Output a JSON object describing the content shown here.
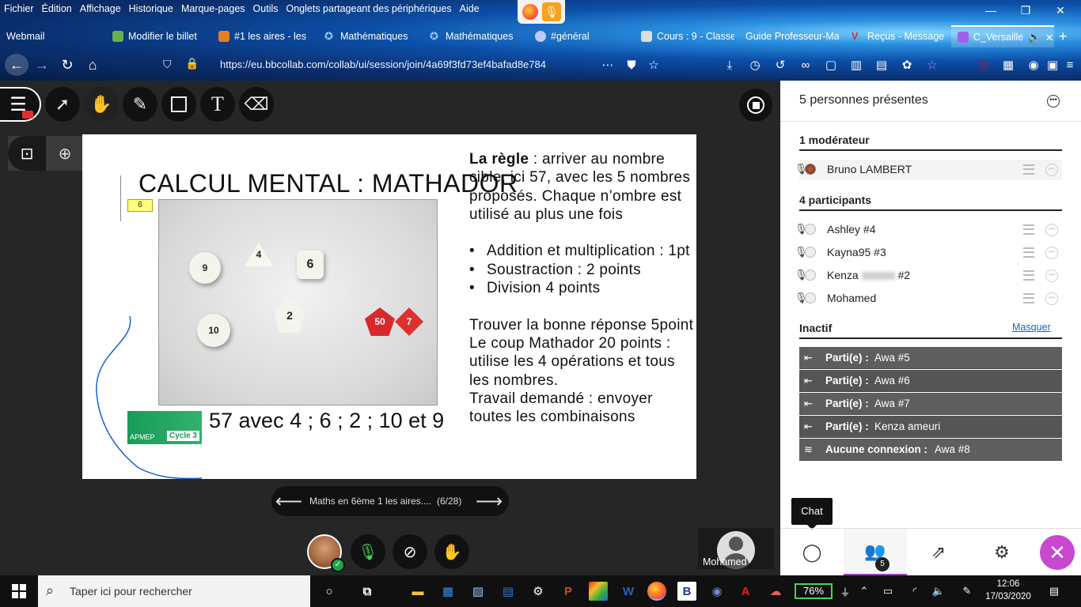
{
  "browser": {
    "menu": [
      "Fichier",
      "Édition",
      "Affichage",
      "Historique",
      "Marque-pages",
      "Outils",
      "Onglets partageant des périphériques",
      "Aide"
    ],
    "tabs": [
      {
        "label": "Webmail",
        "icon": "none",
        "color": ""
      },
      {
        "label": "Modifier le billet",
        "icon": "green-icon",
        "color": "#6ab04c"
      },
      {
        "label": "#1 les aires - les",
        "icon": "orange-icon",
        "color": "#e67e22"
      },
      {
        "label": "Mathématiques",
        "icon": "star-icon",
        "color": "#9ec9ff"
      },
      {
        "label": "Mathématiques",
        "icon": "star-icon",
        "color": "#9ec9ff"
      },
      {
        "label": "#général",
        "icon": "discord-icon",
        "color": "#c0c8ff"
      },
      {
        "label": "Cours : 9 - Classe",
        "icon": "c-icon",
        "color": "#ddd"
      },
      {
        "label": "Guide Professeur-Ma",
        "icon": "none",
        "color": ""
      },
      {
        "label": "Reçus - Message",
        "icon": "mail-icon",
        "color": "#d63031"
      },
      {
        "label": "C_Versaille",
        "icon": "video-icon",
        "color": "#a55eea"
      }
    ],
    "url": "https://eu.bbcollab.com/collab/ui/session/join/4a69f3fd73ef4bafad8e784"
  },
  "stage": {
    "zoom_tools": [
      "Navigation",
      "Zoom avant",
      "Zoom arrière",
      "Ajuster",
      "1:1"
    ],
    "slide": {
      "title": "CALCUL MENTAL : MATHADOR",
      "badge": "6",
      "logo_left": "APMEP",
      "logo_right": "Cycle 3",
      "target_line": "57 avec 4 ; 6 ; 2 ; 10 et 9",
      "rule_bold": "La règle",
      "rule_text": " : arriver au nombre cible, ici 57,  avec les 5 nombres proposés. Chaque n’ombre est utilisé au plus une fois",
      "bullets": [
        "Addition et multiplication : 1pt",
        "Soustraction  : 2 points",
        "Division 4 points"
      ],
      "trouver": "Trouver la bonne réponse 5point",
      "coup": "Le coup Mathador 20 points : utilise les 4 opérations et tous les nombres.",
      "travail": "Travail demandé : envoyer toutes les combinaisons",
      "dice": [
        "4",
        "6",
        "2",
        "10",
        "50",
        "7"
      ]
    },
    "nav": {
      "name": "Maths en 6ème 1 les aires....",
      "count": "(6/28)"
    },
    "tile_name": "Mohamed"
  },
  "panel": {
    "title": "5 personnes présentes",
    "moderators_title": "1 modérateur",
    "moderators": [
      {
        "name": "Bruno LAMBERT"
      }
    ],
    "participants_title": "4 participants",
    "participants": [
      {
        "name": "Ashley #4",
        "suffix": ""
      },
      {
        "name": "Kayna95 #3",
        "suffix": ""
      },
      {
        "name": "Kenza",
        "suffix": "#2"
      },
      {
        "name": "Mohamed",
        "suffix": ""
      }
    ],
    "inactive_title": "Inactif",
    "hide_label": "Masquer",
    "inactive": [
      {
        "label": "Parti(e) :",
        "name": "Awa #5"
      },
      {
        "label": "Parti(e) :",
        "name": "Awa #6"
      },
      {
        "label": "Parti(e) :",
        "name": "Awa #7"
      },
      {
        "label": "Parti(e) :",
        "name": "Kenza ameuri"
      },
      {
        "label": "Aucune connexion :",
        "name": "Awa #8"
      }
    ],
    "chat_tooltip": "Chat",
    "people_badge": "5"
  },
  "taskbar": {
    "search_placeholder": "Taper ici pour rechercher",
    "battery": "76%",
    "time": "12:06",
    "date": "17/03/2020"
  },
  "colors": {
    "accent": "#a040c8",
    "close": "#c848d0",
    "mic_on": "#4bd05a"
  }
}
